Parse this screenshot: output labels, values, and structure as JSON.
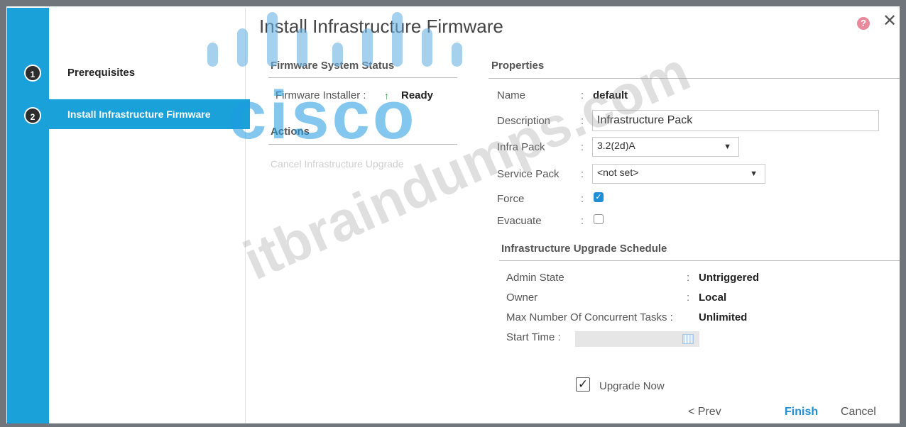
{
  "wizard": {
    "title": "Install Infrastructure Firmware",
    "help_glyph": "?",
    "close_glyph": "✕",
    "steps": [
      {
        "number": "1",
        "label": "Prerequisites"
      },
      {
        "number": "2",
        "label": "Install Infrastructure Firmware"
      }
    ]
  },
  "firmware_status": {
    "heading": "Firmware System Status",
    "installer_label": "Firmware Installer :",
    "installer_value": "Ready"
  },
  "actions": {
    "heading": "Actions",
    "cancel_upgrade_label": "Cancel Infrastructure Upgrade"
  },
  "properties": {
    "heading": "Properties",
    "name_label": "Name",
    "name_value": "default",
    "description_label": "Description",
    "description_value": "Infrastructure Pack",
    "infra_pack_label": "Infra Pack",
    "infra_pack_value": "3.2(2d)A",
    "service_pack_label": "Service Pack",
    "service_pack_value": "<not set>",
    "force_label": "Force",
    "force_checked": true,
    "evacuate_label": "Evacuate",
    "evacuate_checked": false,
    "colon": ":"
  },
  "schedule": {
    "heading": "Infrastructure Upgrade Schedule",
    "admin_state_label": "Admin State",
    "admin_state_value": "Untriggered",
    "owner_label": "Owner",
    "owner_value": "Local",
    "max_tasks_label": "Max Number Of Concurrent Tasks :",
    "max_tasks_value": "Unlimited",
    "start_time_label": "Start Time :",
    "colon": ":"
  },
  "upgrade_now": {
    "label": "Upgrade Now",
    "checked": true,
    "check_glyph": "✓"
  },
  "footer": {
    "prev_label": "< Prev",
    "finish_label": "Finish",
    "cancel_label": "Cancel"
  },
  "watermark": {
    "brand": "cisco",
    "site": "itbraindumps.com"
  },
  "colors": {
    "accent": "#1aa1d9",
    "finish": "#1f8ed6",
    "ready_arrow": "#2aa043"
  }
}
